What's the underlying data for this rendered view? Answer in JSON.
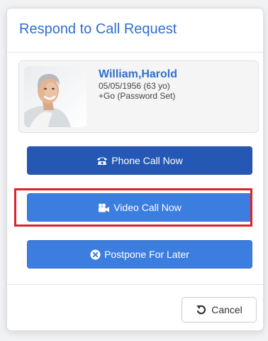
{
  "modal": {
    "title": "Respond to Call Request"
  },
  "patient": {
    "name": "William,Harold",
    "dob_line": "05/05/1956 (63 yo)",
    "status_line": "+Go (Password Set)",
    "photo_icon": "patient-photo"
  },
  "actions": {
    "phone_label": "Phone Call Now",
    "phone_icon": "phone-icon",
    "video_label": "Video Call Now",
    "video_icon": "video-camera-icon",
    "postpone_label": "Postpone For Later",
    "postpone_icon": "close-circle-icon"
  },
  "footer": {
    "cancel_label": "Cancel",
    "cancel_icon": "undo-icon"
  },
  "colors": {
    "accent": "#2f6fce",
    "phone_button": "#2558b4",
    "action_button": "#3c7ee0",
    "highlight": "#e0202a"
  }
}
